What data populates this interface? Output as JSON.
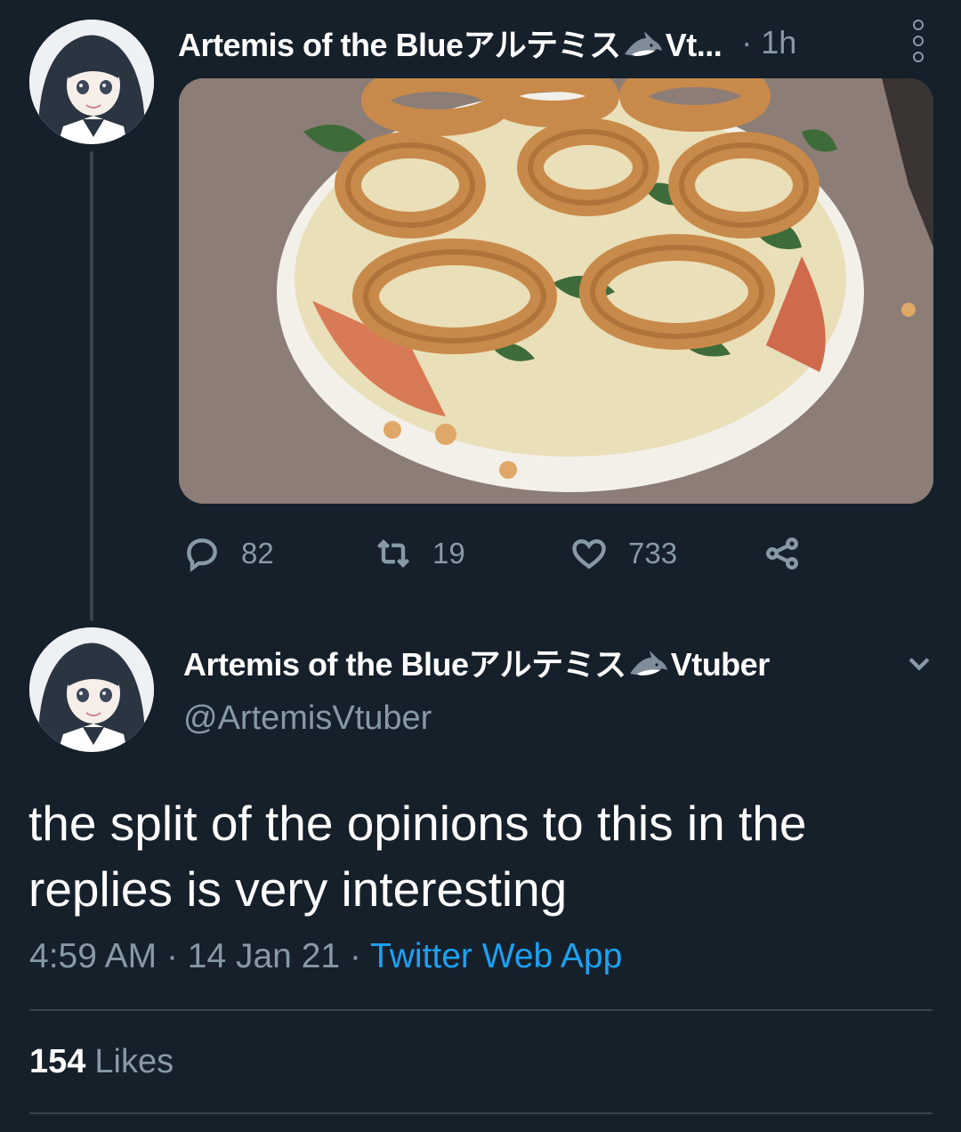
{
  "parent_tweet": {
    "display_name": "Artemis of the Blueアルテミス",
    "display_name_suffix": "Vt...",
    "time": "· 1h",
    "photo_icon": "pizza-photo",
    "actions": {
      "reply_count": "82",
      "retweet_count": "19",
      "like_count": "733"
    }
  },
  "main_tweet": {
    "display_name": "Artemis of the Blueアルテミス",
    "display_name_suffix": "Vtuber",
    "handle": "@ArtemisVtuber",
    "text": "the split of the opinions to this in the replies is very interesting",
    "time": "4:59 AM",
    "date": "14 Jan 21",
    "source": "Twitter Web App",
    "likes_count": "154",
    "likes_label": "Likes"
  },
  "colors": {
    "background": "#15202b",
    "secondary_text": "#8899a6",
    "accent": "#1da1f2",
    "divider": "#38444d"
  }
}
